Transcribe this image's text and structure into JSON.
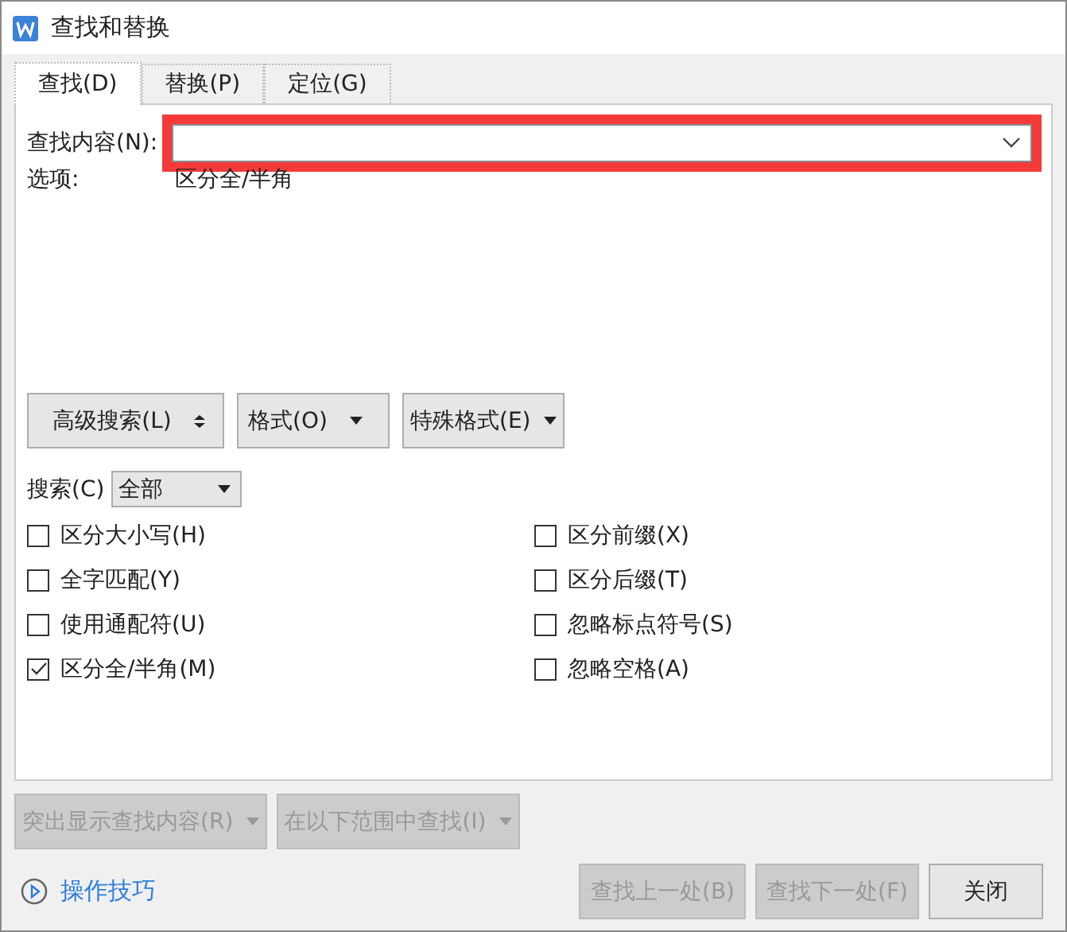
{
  "window": {
    "title": "查找和替换"
  },
  "tabs": [
    {
      "label": "查找(D)",
      "selected": true
    },
    {
      "label": "替换(P)",
      "selected": false
    },
    {
      "label": "定位(G)",
      "selected": false
    }
  ],
  "find_field": {
    "label": "查找内容(N):",
    "highlighted": true
  },
  "options": {
    "label": "选项:",
    "value": "区分全/半角"
  },
  "toolbar_buttons": [
    {
      "label": "高级搜索(L)",
      "kind": "toggle"
    },
    {
      "label": "格式(O)",
      "kind": "menu"
    },
    {
      "label": "特殊格式(E)",
      "kind": "menu"
    }
  ],
  "search_scope": {
    "label": "搜索(C)",
    "value": "全部"
  },
  "checkboxes_left": [
    {
      "label": "区分大小写(H)",
      "checked": false
    },
    {
      "label": "全字匹配(Y)",
      "checked": false
    },
    {
      "label": "使用通配符(U)",
      "checked": false
    },
    {
      "label": "区分全/半角(M)",
      "checked": true
    }
  ],
  "checkboxes_right": [
    {
      "label": "区分前缀(X)",
      "checked": false
    },
    {
      "label": "区分后缀(T)",
      "checked": false
    },
    {
      "label": "忽略标点符号(S)",
      "checked": false
    },
    {
      "label": "忽略空格(A)",
      "checked": false
    }
  ],
  "range_buttons": [
    {
      "label": "突出显示查找内容(R)",
      "disabled": true
    },
    {
      "label": "在以下范围中查找(I)",
      "disabled": true
    }
  ],
  "tips_link": "操作技巧",
  "action_buttons": [
    {
      "label": "查找上一处(B)",
      "disabled": true
    },
    {
      "label": "查找下一处(F)",
      "disabled": true
    },
    {
      "label": "关闭",
      "disabled": false
    }
  ]
}
